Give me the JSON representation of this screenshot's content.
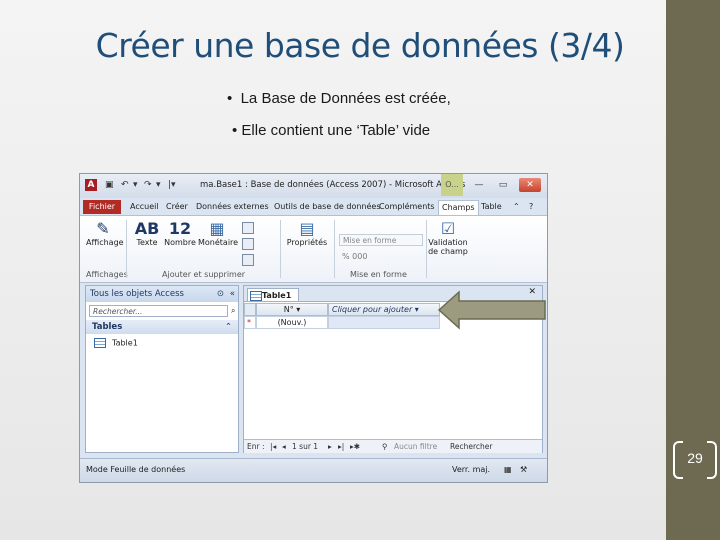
{
  "slide": {
    "title": "Créer une base de données (3/4)",
    "bullets": [
      "La Base de Données est créée,",
      "Elle  contient une ‘Table’  vide"
    ],
    "page_number": "29",
    "colors": {
      "title": "#1f4e79",
      "sidebar": "#6e6a52"
    }
  },
  "access_window": {
    "title": "ma.Base1 : Base de données (Access 2007) - Microsoft Access",
    "context_tab": "O...",
    "tabs": [
      "Fichier",
      "Accueil",
      "Créer",
      "Données externes",
      "Outils de base de données",
      "Compléments",
      "Champs",
      "Table"
    ],
    "ribbon": {
      "view_button": "Affichage",
      "text_button": "Texte",
      "number_button": "Nombre",
      "currency_button": "Monétaire",
      "text_glyph": "AB",
      "number_glyph": "12",
      "properties_button": "Propriétés",
      "format_dropdown": "Mise en forme",
      "format_symbols": "% 000",
      "validation_button": "Validation de champ",
      "groups": [
        "Affichages",
        "Ajouter et supprimer",
        "Mise en forme"
      ]
    },
    "nav_pane": {
      "header": "Tous les objets Access",
      "search_placeholder": "Rechercher...",
      "section": "Tables",
      "items": [
        "Table1"
      ]
    },
    "datasheet": {
      "tab": "Table1",
      "columns": [
        "N°",
        "Cliquer pour ajouter"
      ],
      "new_row_marker": "*",
      "new_row_value": "(Nouv.)",
      "record_nav": {
        "label": "Enr :",
        "position": "1 sur 1",
        "filter": "Aucun filtre",
        "search": "Rechercher"
      }
    },
    "status_bar": {
      "mode": "Mode Feuille de données",
      "numlock": "Verr. maj."
    }
  }
}
